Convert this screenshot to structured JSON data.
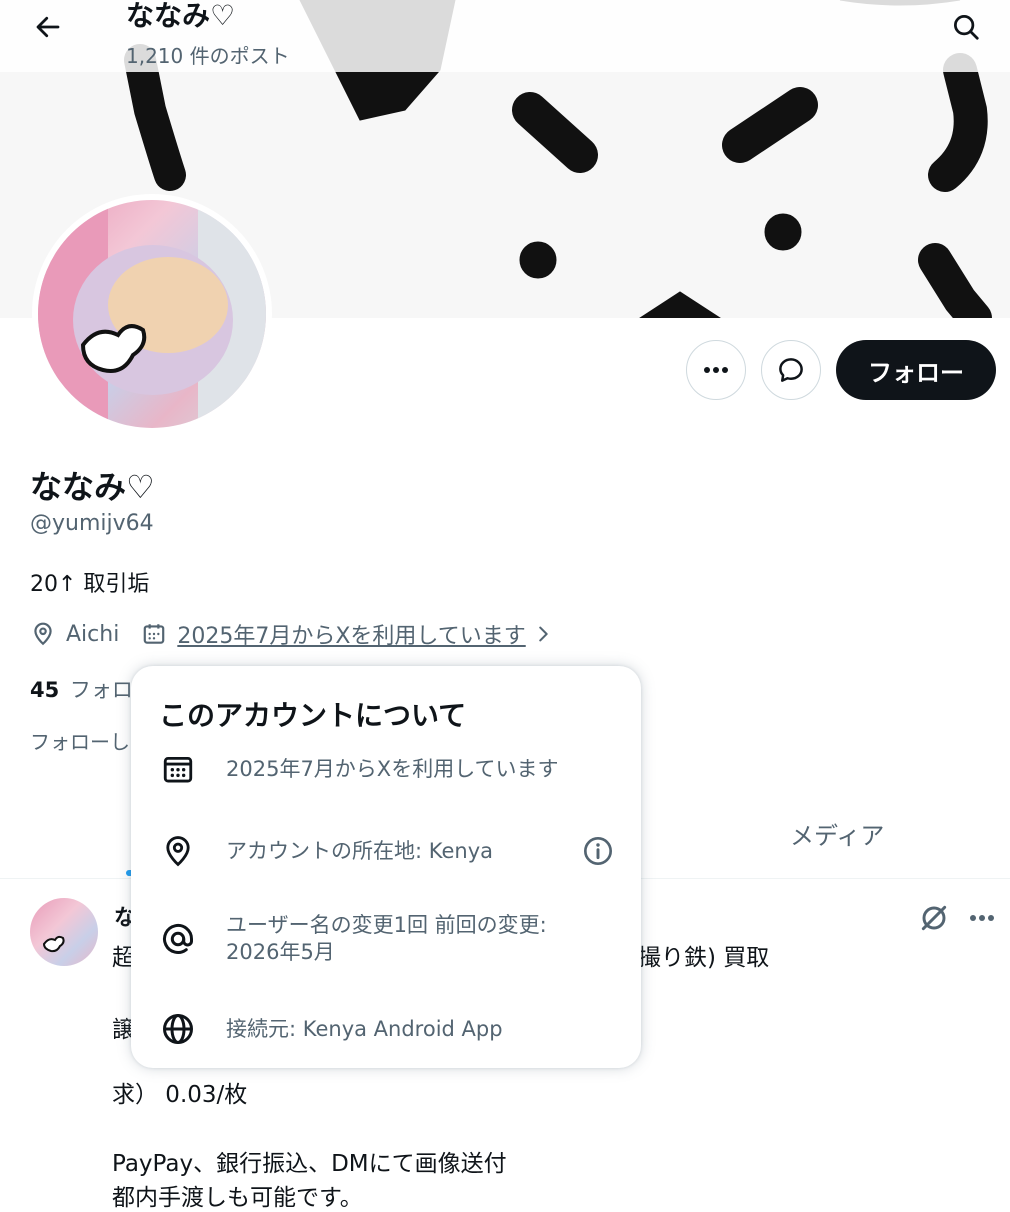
{
  "header": {
    "title": "ななみ♡",
    "post_count": "1,210 件のポスト",
    "back_icon": "arrow-left-icon",
    "search_icon": "search-icon"
  },
  "profile": {
    "display_name": "ななみ♡",
    "handle": "@yumijv64",
    "bio": "20↑ 取引垢",
    "location": "Aichi",
    "joined": "2025年7月からXを利用しています",
    "following_count": "45",
    "following_label_visible": "フォロ",
    "followed_by_visible": "フォローし"
  },
  "actions": {
    "follow_label": "フォロー"
  },
  "tabs": {
    "media_label": "メディア"
  },
  "popover": {
    "title": "このアカウントについて",
    "rows": [
      {
        "icon": "calendar-icon",
        "text": "2025年7月からXを利用しています"
      },
      {
        "icon": "location-pin-icon",
        "text": "アカウントの所在地: Kenya"
      },
      {
        "icon": "at-sign-icon",
        "text": "ユーザー名の変更1回 前回の変更: 2026年5月"
      },
      {
        "icon": "globe-icon",
        "text": "接続元: Kenya Android App"
      }
    ]
  },
  "post": {
    "author_visible": "な",
    "lines": [
      {
        "left": "超",
        "right": "撮り鉄) 買取"
      },
      {
        "left": "譲",
        "right": ""
      },
      {
        "left": "求） 0.03/枚",
        "right": ""
      },
      {
        "left": "PayPay、銀行振込、DMにて画像送付",
        "right": ""
      },
      {
        "left": "都内手渡しも可能です。",
        "right": ""
      }
    ]
  },
  "colors": {
    "text_primary": "#0f1419",
    "text_secondary": "#536471",
    "follow_button_bg": "#0f1419",
    "accent": "#1d9bf0"
  }
}
